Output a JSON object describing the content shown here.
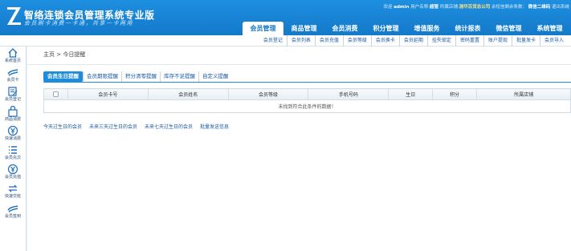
{
  "header": {
    "title": "智络连锁会员管理系统专业版",
    "slogan": "会员刷卡消费一卡通，共享一卡两用",
    "userbar": {
      "welcome": "欢迎",
      "username": "admin",
      "name_label": "用户名称:",
      "name": "超管",
      "shop_label": "所属店铺:",
      "shop": "测华百货总公司",
      "sms": "余短信剩余条数：",
      "service": "微信二维码",
      "logout": "退出系统"
    }
  },
  "main_nav": [
    "会员管理",
    "商品管理",
    "会员消费",
    "积分管理",
    "增值服务",
    "统计报表",
    "微信管理",
    "系统管理"
  ],
  "sub_nav": [
    "会员登记",
    "会员列表",
    "会员充值",
    "会员等级",
    "会员换卡",
    "会员延期",
    "挂失锁定",
    "密码重置",
    "账户提现",
    "批量发卡",
    "会员导入"
  ],
  "sidebar": [
    {
      "label": "系统首页",
      "icon": "home-icon"
    },
    {
      "label": "会员卡",
      "icon": "card-icon"
    },
    {
      "label": "会员登记",
      "icon": "edit-icon"
    },
    {
      "label": "商品消费",
      "icon": "bag-icon"
    },
    {
      "label": "快速消费",
      "icon": "yen-icon"
    },
    {
      "label": "会员充次",
      "icon": "list-icon"
    },
    {
      "label": "会员充值",
      "icon": "yen-icon"
    },
    {
      "label": "快速交班",
      "icon": "exchange-icon"
    },
    {
      "label": "会员签到",
      "icon": "card-icon"
    }
  ],
  "breadcrumb": {
    "home": "主页",
    "sep": ">",
    "current": "今日提醒"
  },
  "tabs": [
    "会员生日提醒",
    "会员期限提醒",
    "积分清零提醒",
    "库存不足提醒",
    "自定义提醒"
  ],
  "table": {
    "headers": [
      "会员卡号",
      "会员姓名",
      "会员等级",
      "手机号码",
      "生日",
      "积分",
      "所属店铺"
    ],
    "empty_message": "未找到符合此条件的数据！"
  },
  "quick_links": [
    "今天过生日的会员",
    "未来三天过生日的会员",
    "未来七天过生日的会员",
    "批量发送信息"
  ]
}
